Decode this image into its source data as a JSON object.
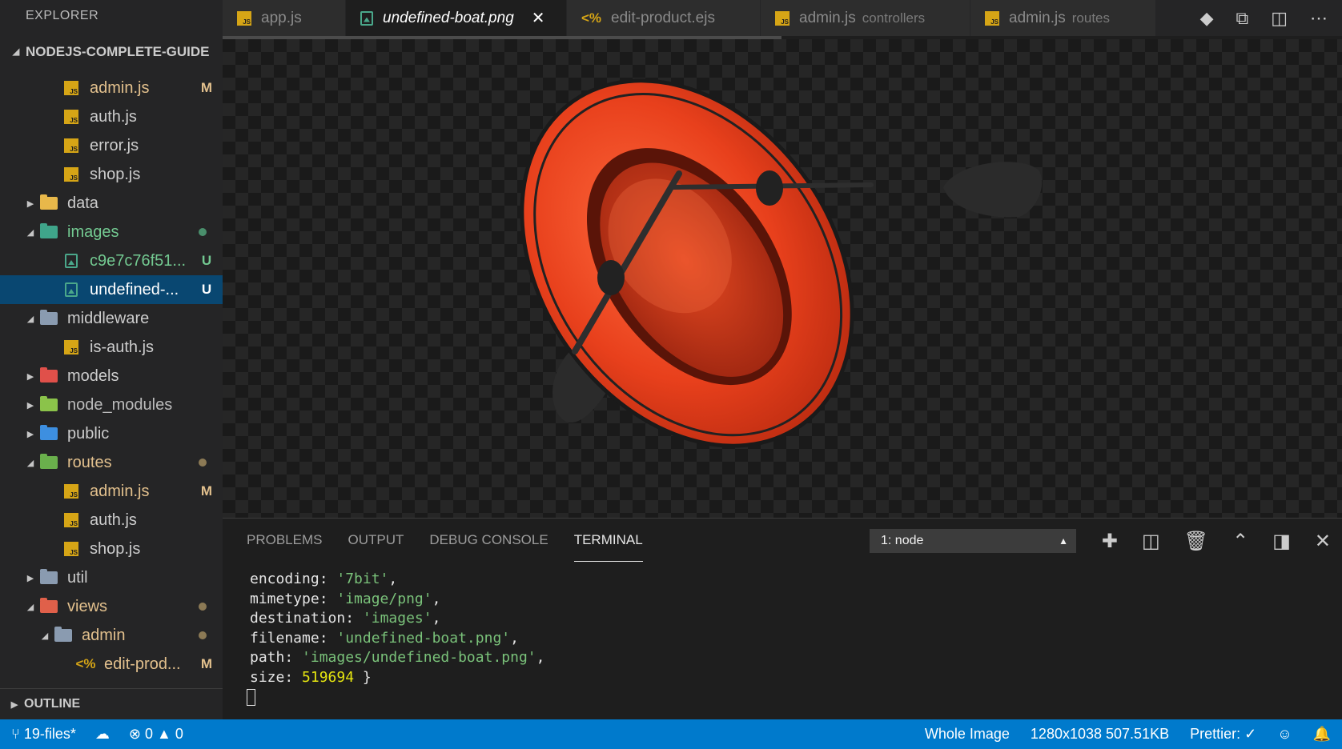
{
  "sidebar": {
    "title": "EXPLORER",
    "section": "NODEJS-COMPLETE-GUIDE",
    "outline": "OUTLINE",
    "items": [
      {
        "label": "admin.js",
        "badge": "M",
        "color": "#e2c08d"
      },
      {
        "label": "auth.js",
        "badge": "",
        "color": "#cccccc"
      },
      {
        "label": "error.js",
        "badge": "",
        "color": "#cccccc"
      },
      {
        "label": "shop.js",
        "badge": "",
        "color": "#cccccc"
      },
      {
        "label": "data",
        "badge": "",
        "color": "#cccccc"
      },
      {
        "label": "images",
        "badge": "",
        "color": "#73c991"
      },
      {
        "label": "c9e7c76f51...",
        "badge": "U",
        "color": "#73c991"
      },
      {
        "label": "undefined-...",
        "badge": "U",
        "color": "#ffffff"
      },
      {
        "label": "middleware",
        "badge": "",
        "color": "#cccccc"
      },
      {
        "label": "is-auth.js",
        "badge": "",
        "color": "#cccccc"
      },
      {
        "label": "models",
        "badge": "",
        "color": "#cccccc"
      },
      {
        "label": "node_modules",
        "badge": "",
        "color": "#bbbbbb"
      },
      {
        "label": "public",
        "badge": "",
        "color": "#cccccc"
      },
      {
        "label": "routes",
        "badge": "",
        "color": "#e2c08d"
      },
      {
        "label": "admin.js",
        "badge": "M",
        "color": "#e2c08d"
      },
      {
        "label": "auth.js",
        "badge": "",
        "color": "#cccccc"
      },
      {
        "label": "shop.js",
        "badge": "",
        "color": "#cccccc"
      },
      {
        "label": "util",
        "badge": "",
        "color": "#cccccc"
      },
      {
        "label": "views",
        "badge": "",
        "color": "#e2c08d"
      },
      {
        "label": "admin",
        "badge": "",
        "color": "#e2c08d"
      },
      {
        "label": "edit-prod...",
        "badge": "M",
        "color": "#e2c08d"
      }
    ]
  },
  "tabs": [
    {
      "label": "app.js",
      "desc": ""
    },
    {
      "label": "undefined-boat.png",
      "desc": ""
    },
    {
      "label": "edit-product.ejs",
      "desc": ""
    },
    {
      "label": "admin.js",
      "desc": "controllers"
    },
    {
      "label": "admin.js",
      "desc": "routes"
    }
  ],
  "panel": {
    "tabs": [
      "PROBLEMS",
      "OUTPUT",
      "DEBUG CONSOLE",
      "TERMINAL"
    ],
    "terminal_select": "1: node",
    "terminal": {
      "encoding_key": "encoding: ",
      "encoding_val": "'7bit'",
      "mimetype_key": "mimetype: ",
      "mimetype_val": "'image/png'",
      "destination_key": "destination: ",
      "destination_val": "'images'",
      "filename_key": "filename: ",
      "filename_val": "'undefined-boat.png'",
      "path_key": "path: ",
      "path_val": "'images/undefined-boat.png'",
      "size_key": "size: ",
      "size_val": "519694",
      "close": " }"
    }
  },
  "statusbar": {
    "branch": "19-files*",
    "errors": "0",
    "warnings": "0",
    "mode": "Whole Image",
    "image_info": "1280x1038 507.51KB",
    "prettier": "Prettier: ✓"
  },
  "colors": {
    "accent": "#007acc",
    "selection": "#094771",
    "modified": "#e2c08d",
    "untracked": "#73c991",
    "boat_red": "#e8401c"
  }
}
